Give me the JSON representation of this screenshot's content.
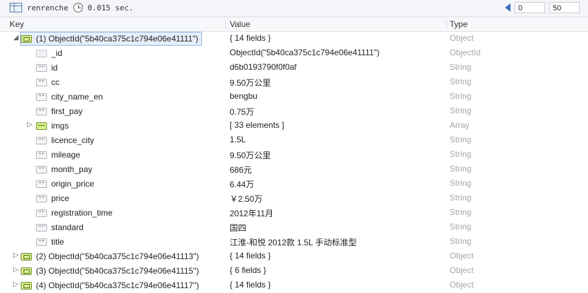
{
  "topbar": {
    "collection": "renrenche",
    "time": "0.015 sec.",
    "page_from": "0",
    "page_size": "50"
  },
  "columns": {
    "key": "Key",
    "value": "Value",
    "type": "Type"
  },
  "rows": [
    {
      "expander": "◢",
      "icon": "document",
      "key": "(1) ObjectId(\"5b40ca375c1c794e06e41111\")",
      "value": "{ 14 fields }",
      "type": "Object",
      "level": 0,
      "selected": true
    },
    {
      "expander": "",
      "icon": "id",
      "key": "_id",
      "value": "ObjectId(\"5b40ca375c1c794e06e41111\")",
      "type": "ObjectId",
      "level": 1
    },
    {
      "expander": "",
      "icon": "string",
      "key": "id",
      "value": "d6b0193790f0f0af",
      "type": "String",
      "level": 1
    },
    {
      "expander": "",
      "icon": "string",
      "key": "cc",
      "value": "9.50万公里",
      "type": "String",
      "level": 1
    },
    {
      "expander": "",
      "icon": "string",
      "key": "city_name_en",
      "value": "bengbu",
      "type": "String",
      "level": 1
    },
    {
      "expander": "",
      "icon": "string",
      "key": "first_pay",
      "value": "0.75万",
      "type": "String",
      "level": 1
    },
    {
      "expander": "▷",
      "icon": "array",
      "key": "imgs",
      "value": "[ 33 elements ]",
      "type": "Array",
      "level": 1
    },
    {
      "expander": "",
      "icon": "string",
      "key": "licence_city",
      "value": "1.5L",
      "type": "String",
      "level": 1
    },
    {
      "expander": "",
      "icon": "string",
      "key": "mileage",
      "value": "9.50万公里",
      "type": "String",
      "level": 1
    },
    {
      "expander": "",
      "icon": "string",
      "key": "month_pay",
      "value": "686元",
      "type": "String",
      "level": 1
    },
    {
      "expander": "",
      "icon": "string",
      "key": "origin_price",
      "value": "6.44万",
      "type": "String",
      "level": 1
    },
    {
      "expander": "",
      "icon": "string",
      "key": "price",
      "value": "￥2.50万",
      "type": "String",
      "level": 1
    },
    {
      "expander": "",
      "icon": "string",
      "key": "registration_time",
      "value": "2012年11月",
      "type": "String",
      "level": 1
    },
    {
      "expander": "",
      "icon": "string",
      "key": "standard",
      "value": "国四",
      "type": "String",
      "level": 1
    },
    {
      "expander": "",
      "icon": "string",
      "key": "title",
      "value": "江淮-和悦 2012款 1.5L 手动标准型",
      "type": "String",
      "level": 1
    },
    {
      "expander": "▷",
      "icon": "document",
      "key": "(2) ObjectId(\"5b40ca375c1c794e06e41113\")",
      "value": "{ 14 fields }",
      "type": "Object",
      "level": 0
    },
    {
      "expander": "▷",
      "icon": "document",
      "key": "(3) ObjectId(\"5b40ca375c1c794e06e41115\")",
      "value": "{ 6 fields }",
      "type": "Object",
      "level": 0
    },
    {
      "expander": "▷",
      "icon": "document",
      "key": "(4) ObjectId(\"5b40ca375c1c794e06e41117\")",
      "value": "{ 14 fields }",
      "type": "Object",
      "level": 0
    }
  ]
}
